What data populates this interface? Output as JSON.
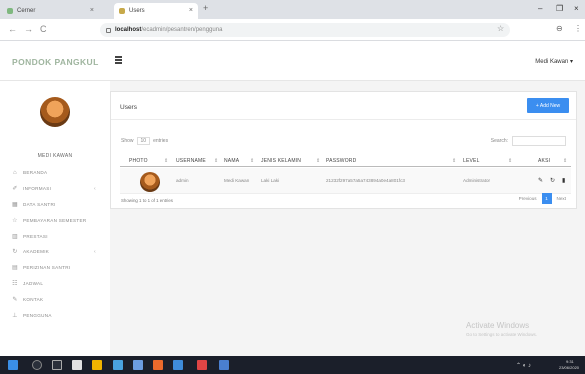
{
  "browser": {
    "tabs": [
      {
        "label": "Cerner",
        "close": "×"
      },
      {
        "label": "Users",
        "close": "×"
      }
    ],
    "new_tab": "+",
    "window_controls": [
      "–",
      "❐",
      "×"
    ],
    "nav": {
      "back": "←",
      "forward": "→",
      "reload": "C"
    },
    "url_host": "localhost",
    "url_path": "/ecadmin/pesantren/pengguna",
    "star": "☆",
    "right_icons": [
      "⊖",
      "⋮"
    ]
  },
  "app": {
    "brand": "PONDOK PANGKUL",
    "user_menu": "Medi Kawan ▾"
  },
  "sidebar": {
    "user_name": "MEDI KAWAN",
    "items": [
      {
        "label": "BERANDA",
        "icon": "home-icon",
        "glyph": "⌂",
        "arrow": ""
      },
      {
        "label": "INFORMASI",
        "icon": "info-icon",
        "glyph": "✐",
        "arrow": "‹"
      },
      {
        "label": "DATA SANTRI",
        "icon": "table-icon",
        "glyph": "▦",
        "arrow": ""
      },
      {
        "label": "PEMBAYARAN SEMESTER",
        "icon": "star-icon",
        "glyph": "☆",
        "arrow": ""
      },
      {
        "label": "PRESTASI",
        "icon": "bar-icon",
        "glyph": "▥",
        "arrow": ""
      },
      {
        "label": "AKADEMIK",
        "icon": "refresh-icon",
        "glyph": "↻",
        "arrow": "‹"
      },
      {
        "label": "PERIZINAN SANTRI",
        "icon": "grid-icon",
        "glyph": "▤",
        "arrow": ""
      },
      {
        "label": "JADWAL",
        "icon": "calendar-icon",
        "glyph": "☷",
        "arrow": ""
      },
      {
        "label": "KONTAK",
        "icon": "pencil-icon",
        "glyph": "✎",
        "arrow": ""
      },
      {
        "label": "PENGGUNA",
        "icon": "user-icon",
        "glyph": "⊥",
        "arrow": ""
      }
    ]
  },
  "panel": {
    "title": "Users",
    "add_button": "+ Add New",
    "show_label": "Show",
    "entries_value": "10",
    "entries_label": "entries",
    "search_label": "Search:",
    "columns": [
      "PHOTO",
      "USERNAME",
      "NAMA",
      "JENIS KELAMIN",
      "PASSWORD",
      "LEVEL",
      "AKSI"
    ],
    "sort_icon": "⇕",
    "rows": [
      {
        "username": "admin",
        "nama": "Medi Kawan",
        "jenis_kelamin": "Laki Laki",
        "password": "21232f297a57a5a743894a0e4a801fc3",
        "level": "Administrator"
      }
    ],
    "action_icons": {
      "edit": "✎",
      "refresh": "↻",
      "delete": "▮"
    },
    "info": "Showing 1 to 1 of 1 entries",
    "pager": {
      "previous": "Previous",
      "page": "1",
      "next": "Next"
    }
  },
  "watermark": {
    "title": "Activate Windows",
    "subtitle": "Go to Settings to activate Windows."
  },
  "taskbar": {
    "time": "9:31",
    "date": "23/06/2020"
  },
  "colors": {
    "accent": "#3b8ef0",
    "brand": "#9fb59f",
    "taskbar": "#1b1f2a"
  }
}
